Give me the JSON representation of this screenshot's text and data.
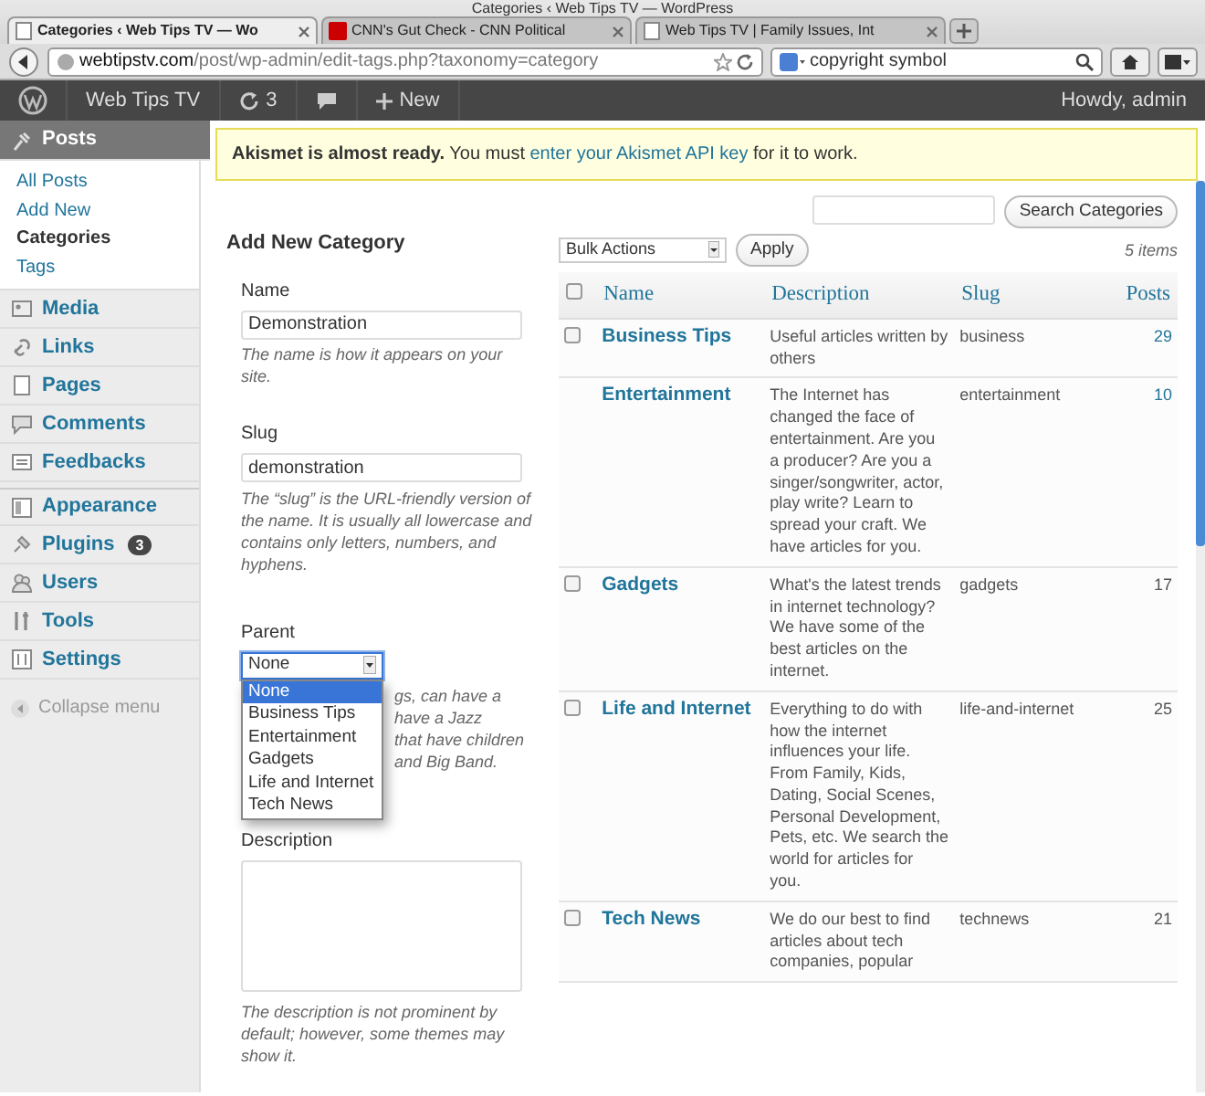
{
  "window": {
    "title": "Categories ‹ Web Tips TV — WordPress"
  },
  "tabs": [
    {
      "label": "Categories ‹ Web Tips TV — Wo",
      "selected": true,
      "kind": "page"
    },
    {
      "label": "CNN's Gut Check - CNN Political",
      "selected": false,
      "kind": "cnn"
    },
    {
      "label": "Web Tips TV | Family Issues, Int",
      "selected": false,
      "kind": "page"
    }
  ],
  "address_bar": {
    "domain": "webtipstv.com",
    "path": "/post/wp-admin/edit-tags.php?taxonomy=category"
  },
  "search_field": {
    "value": "copyright symbol"
  },
  "admin_bar": {
    "site": "Web Tips TV",
    "updates": "3",
    "new": "New",
    "greeting": "Howdy, admin"
  },
  "sidebar": {
    "items": [
      {
        "label": "Posts",
        "selected": true,
        "children": [
          {
            "label": "All Posts",
            "selected": false
          },
          {
            "label": "Add New",
            "selected": false
          },
          {
            "label": "Categories",
            "selected": true
          },
          {
            "label": "Tags",
            "selected": false
          }
        ]
      },
      {
        "label": "Media",
        "selected": false
      },
      {
        "label": "Links",
        "selected": false
      },
      {
        "label": "Pages",
        "selected": false
      },
      {
        "label": "Comments",
        "selected": false
      },
      {
        "label": "Feedbacks",
        "selected": false
      },
      {
        "label": "Appearance",
        "selected": false
      },
      {
        "label": "Plugins",
        "selected": false,
        "badge": "3"
      },
      {
        "label": "Users",
        "selected": false
      },
      {
        "label": "Tools",
        "selected": false
      },
      {
        "label": "Settings",
        "selected": false
      }
    ],
    "collapse": "Collapse menu"
  },
  "notice": {
    "text": "**Akismet is almost ready.** You must ",
    "link": "enter your Akismet API key",
    "after": " for it to work."
  },
  "form": {
    "title": "Add New Category",
    "name": {
      "label": "Name",
      "value": "Demonstration",
      "help": "The name is how it appears on your site."
    },
    "slug": {
      "label": "Slug",
      "value": "demonstration",
      "help": "The “slug” is the URL-friendly version of the name. It is usually all lowercase and contains only letters, numbers, and hyphens."
    },
    "parent": {
      "label": "Parent",
      "value": "None",
      "expanded": true,
      "options": [
        {
          "label": "None",
          "selected": true
        },
        {
          "label": "Business Tips",
          "selected": false
        },
        {
          "label": "Entertainment",
          "selected": false
        },
        {
          "label": "Gadgets",
          "selected": false
        },
        {
          "label": "Life and Internet",
          "selected": false
        },
        {
          "label": "Tech News",
          "selected": false
        }
      ],
      "help_visible": [
        "gs, can have a",
        "have a Jazz",
        "that have children",
        "and Big Band."
      ]
    },
    "description": {
      "label": "Description",
      "help": "The description is not prominent by default; however, some themes may show it."
    }
  },
  "search_button": "Search Categories",
  "bulk": {
    "value": "Bulk Actions",
    "apply": "Apply",
    "count": "5 items"
  },
  "table": {
    "columns": [
      "Name",
      "Description",
      "Slug",
      "Posts"
    ],
    "select_all_checked": false,
    "rows": [
      {
        "kind": "normal",
        "name": "Business Tips",
        "description": "Useful articles written by others",
        "slug": "business",
        "posts": "29",
        "checked": false
      },
      {
        "kind": "default",
        "name": "Entertainment",
        "description": "The Internet has changed the face of entertainment. Are you a producer? Are you a singer/songwriter, actor, play write? Learn to spread your craft. We have articles for you.",
        "slug": "entertainment",
        "posts": "10"
      },
      {
        "kind": "normal",
        "name": "Gadgets",
        "description": "What's the latest trends in internet technology? We have some of the best articles on the internet.",
        "slug": "gadgets",
        "posts": "17",
        "checked": false
      },
      {
        "kind": "normal",
        "name": "Life and Internet",
        "description": "Everything to do with how the internet influences your life. From Family, Kids, Dating, Social Scenes, Personal Development, Pets, etc. We search the world for articles for you.",
        "slug": "life-and-internet",
        "posts": "25",
        "checked": false
      },
      {
        "kind": "normal",
        "name": "Tech News",
        "description": "We do our best to find articles about tech companies, popular",
        "slug": "technews",
        "posts": "21",
        "checked": false
      }
    ]
  }
}
